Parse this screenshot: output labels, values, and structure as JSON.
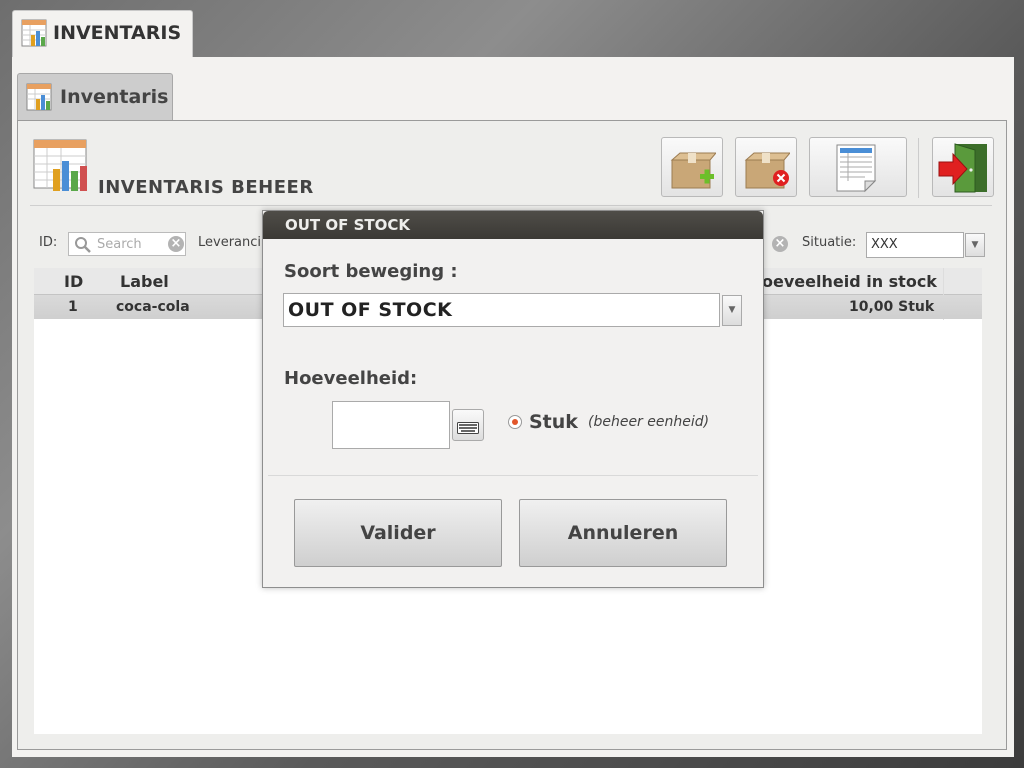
{
  "app": {
    "title": "INVENTARIS"
  },
  "tab": {
    "label": "Inventaris"
  },
  "header": {
    "title": "INVENTARIS BEHEER"
  },
  "toolbar": {
    "buttons": [
      {
        "icon": "box-add-icon"
      },
      {
        "icon": "box-remove-icon"
      },
      {
        "icon": "spreadsheet-report-icon"
      },
      {
        "icon": "exit-door-icon"
      }
    ]
  },
  "filters": {
    "id_label": "ID:",
    "search_placeholder": "Search",
    "supplier_label": "Leveranci",
    "situation_label": "Situatie:",
    "situation_value": "XXX"
  },
  "table": {
    "columns": [
      "ID",
      "Label",
      "oeveelheid in stock"
    ],
    "rows": [
      {
        "id": "1",
        "label": "coca-cola",
        "stock": "10,00 Stuk"
      }
    ]
  },
  "dialog": {
    "title": "OUT OF STOCK",
    "movement_label": "Soort beweging :",
    "movement_value": "OUT OF STOCK",
    "quantity_label": "Hoeveelheid:",
    "quantity_value": "",
    "unit_label": "Stuk",
    "unit_hint": "(beheer eenheid)",
    "confirm_label": "Valider",
    "cancel_label": "Annuleren"
  },
  "colors": {
    "dialog_header": "#3f3d39",
    "radio_accent": "#e2562a",
    "exit_arrow": "#e02020",
    "add_plus": "#6cbf2a"
  }
}
